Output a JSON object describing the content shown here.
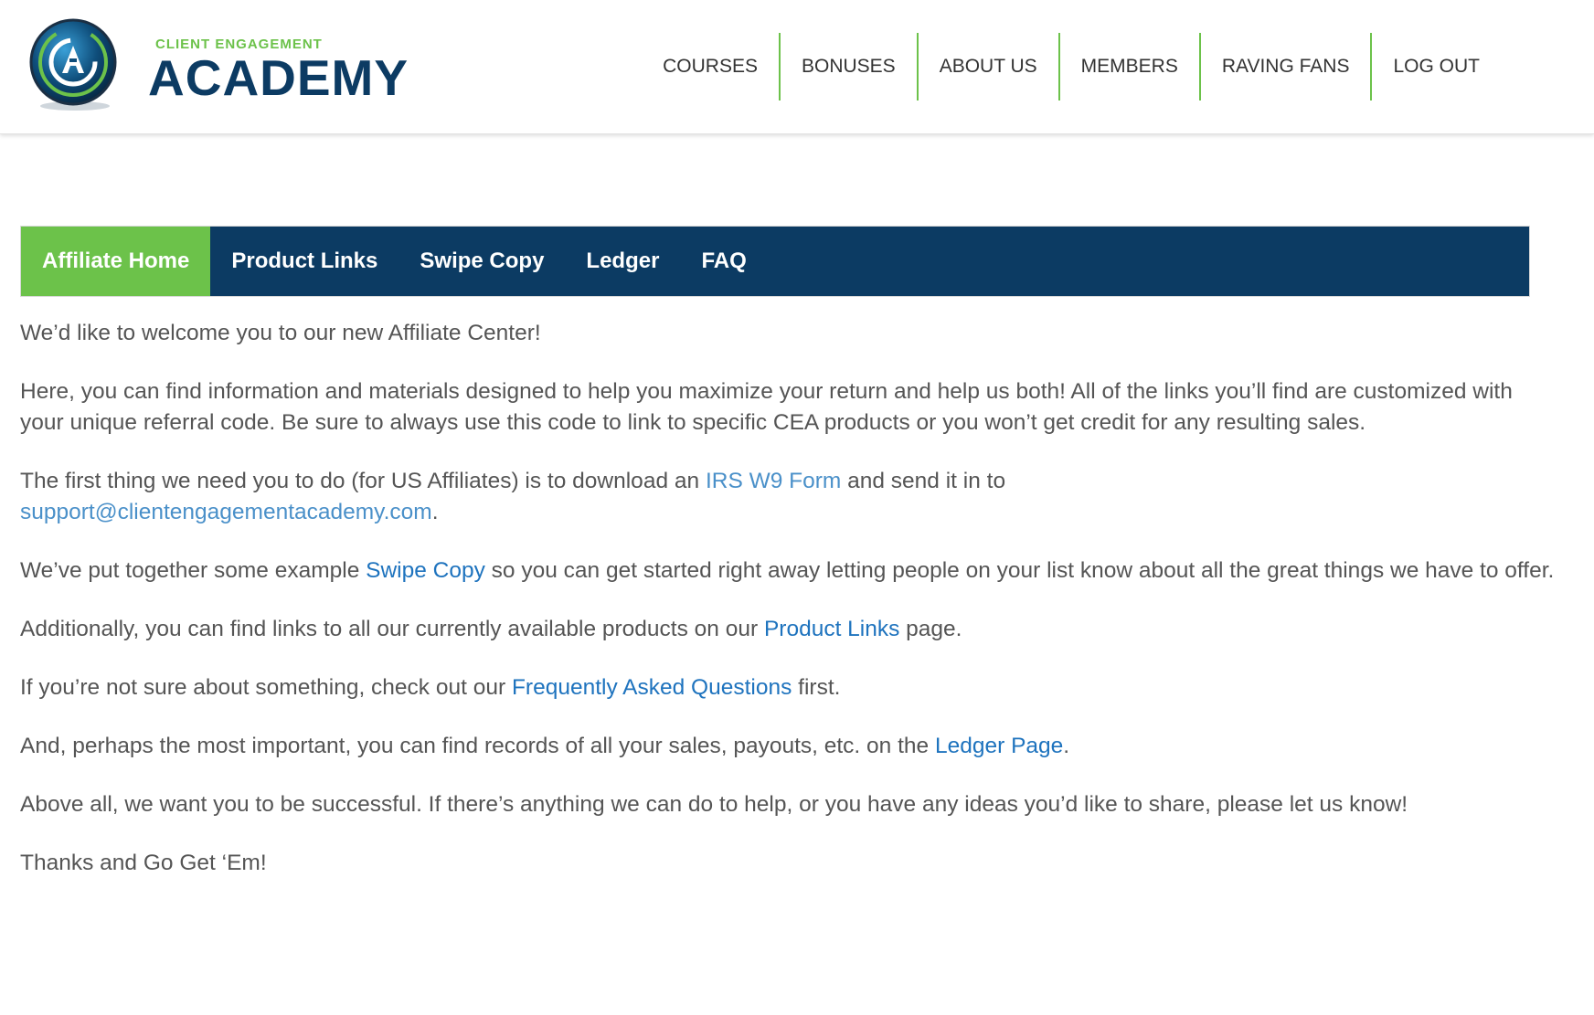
{
  "header": {
    "logo": {
      "tagline": "CLIENT ENGAGEMENT",
      "name": "ACADEMY"
    },
    "nav": [
      {
        "label": "COURSES"
      },
      {
        "label": "BONUSES"
      },
      {
        "label": "ABOUT US"
      },
      {
        "label": "MEMBERS"
      },
      {
        "label": "RAVING FANS"
      },
      {
        "label": "LOG OUT"
      }
    ]
  },
  "tabs": [
    {
      "label": "Affiliate Home",
      "active": true
    },
    {
      "label": "Product Links",
      "active": false
    },
    {
      "label": "Swipe Copy",
      "active": false
    },
    {
      "label": "Ledger",
      "active": false
    },
    {
      "label": "FAQ",
      "active": false
    }
  ],
  "content": {
    "welcome": "We’d like to welcome you to our new Affiliate Center!",
    "intro": "Here, you can find information and materials designed to help you maximize your return and help us both! All of the links you’ll find are customized with your unique referral code. Be sure to always use this code to link to specific CEA products or you won’t get credit for any resulting sales.",
    "w9": {
      "before": "The first thing we need you to do (for US Affiliates) is to download an ",
      "link": "IRS W9 Form",
      "middle": " and send it in to ",
      "email": "support@clientengagementacademy.com",
      "after": "."
    },
    "swipe": {
      "before": "We’ve put together some example ",
      "link": "Swipe Copy",
      "after": " so you can get started right away letting people on your list know about all the great things we have to offer."
    },
    "products": {
      "before": "Additionally, you can find links to all our currently available products on our ",
      "link": "Product Links",
      "after": " page."
    },
    "faq": {
      "before": "If you’re not sure about something, check out our ",
      "link": "Frequently Asked Questions",
      "after": " first."
    },
    "ledger": {
      "before": "And, perhaps the most important, you can find records of all your sales, payouts, etc. on the ",
      "link": "Ledger Page",
      "after": "."
    },
    "success": "Above all, we want you to be successful. If there’s anything we can do to help, or you have any ideas you’d like to share, please let us know!",
    "thanks": "Thanks and Go Get ‘Em!"
  },
  "colors": {
    "brand_navy": "#0c3b63",
    "brand_green": "#6cc24a",
    "link_blue": "#1e73be",
    "body_text": "#555555"
  },
  "icons": {
    "logo": "globe-logo-icon"
  }
}
